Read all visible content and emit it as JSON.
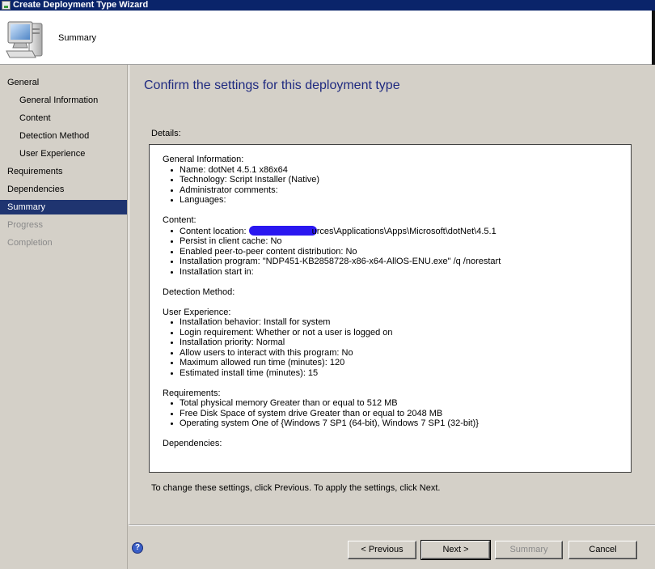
{
  "window": {
    "title": "Create Deployment Type Wizard"
  },
  "header": {
    "page": "Summary"
  },
  "nav": {
    "items": [
      {
        "label": "General",
        "level": 1,
        "state": "normal"
      },
      {
        "label": "General Information",
        "level": 2,
        "state": "normal"
      },
      {
        "label": "Content",
        "level": 2,
        "state": "normal"
      },
      {
        "label": "Detection Method",
        "level": 2,
        "state": "normal"
      },
      {
        "label": "User Experience",
        "level": 2,
        "state": "normal"
      },
      {
        "label": "Requirements",
        "level": 1,
        "state": "normal"
      },
      {
        "label": "Dependencies",
        "level": 1,
        "state": "normal"
      },
      {
        "label": "Summary",
        "level": 1,
        "state": "selected"
      },
      {
        "label": "Progress",
        "level": 1,
        "state": "disabled"
      },
      {
        "label": "Completion",
        "level": 1,
        "state": "disabled"
      }
    ]
  },
  "main": {
    "title": "Confirm the settings for this deployment type",
    "details_label": "Details:",
    "footer_note": "To change these settings, click Previous. To apply the settings, click Next.",
    "details": {
      "general": {
        "title": "General Information:",
        "items": [
          "Name: dotNet 4.5.1 x86x64",
          "Technology: Script Installer (Native)",
          "Administrator comments:",
          "Languages:"
        ]
      },
      "content": {
        "title": "Content:",
        "location_prefix": "Content location: ",
        "location_suffix": "urces\\Applications\\Apps\\Microsoft\\dotNet\\4.5.1",
        "items": [
          "Persist in client cache: No",
          "Enabled peer-to-peer content distribution: No",
          "Installation program: \"NDP451-KB2858728-x86-x64-AllOS-ENU.exe\" /q /norestart",
          "Installation start in:"
        ]
      },
      "detection": {
        "title": "Detection Method:"
      },
      "user_experience": {
        "title": "User Experience:",
        "items": [
          "Installation behavior: Install for system",
          "Login requirement: Whether or not a user is logged on",
          "Installation priority: Normal",
          "Allow users to interact with this program: No",
          "Maximum allowed run time (minutes): 120",
          "Estimated install time (minutes): 15"
        ]
      },
      "requirements": {
        "title": "Requirements:",
        "items": [
          "Total physical memory  Greater than or equal to  512 MB",
          "Free Disk Space of system drive  Greater than or equal to  2048 MB",
          "Operating system  One of  {Windows 7 SP1 (64-bit), Windows 7 SP1 (32-bit)}"
        ]
      },
      "dependencies": {
        "title": "Dependencies:"
      }
    }
  },
  "buttons": {
    "help": "?",
    "previous": "< Previous",
    "next": "Next >",
    "summary": "Summary",
    "cancel": "Cancel"
  },
  "colors": {
    "titlebar": "#0a246a",
    "nav_selected": "#1f3470",
    "page_title": "#1f2a80",
    "redaction": "#2a17f0"
  }
}
